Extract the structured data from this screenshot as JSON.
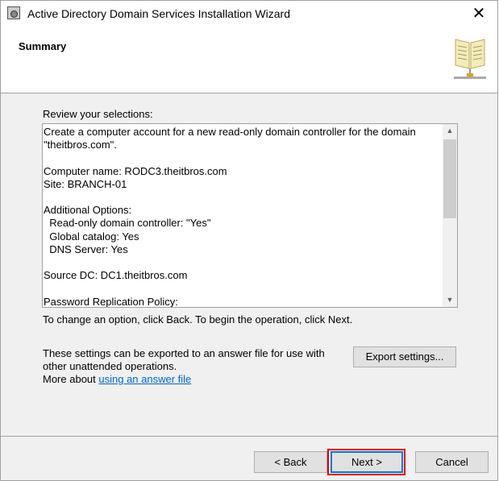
{
  "window": {
    "title": "Active Directory Domain Services Installation Wizard",
    "close_icon": "close-icon"
  },
  "header": {
    "heading": "Summary",
    "icon": "book-network-icon"
  },
  "review_label": "Review your selections:",
  "summary_lines": [
    "Create a computer account for a new read-only domain controller for the domain",
    "\"theitbros.com\".",
    "",
    "Computer name: RODC3.theitbros.com",
    "Site: BRANCH-01",
    "",
    "Additional Options:",
    "  Read-only domain controller: \"Yes\"",
    "  Global catalog: Yes",
    "  DNS Server: Yes",
    "",
    "Source DC: DC1.theitbros.com",
    "",
    "Password Replication Policy:"
  ],
  "change_hint": "To change an option, click Back. To begin the operation, click Next.",
  "export_text_1": "These settings can be exported to an answer file for use with",
  "export_text_2": "other unattended operations.",
  "more_about": "More about ",
  "answer_file_link": "using an answer file",
  "buttons": {
    "export": "Export settings...",
    "back": "< Back",
    "next": "Next >",
    "cancel": "Cancel"
  },
  "highlight_color": "#e00000"
}
